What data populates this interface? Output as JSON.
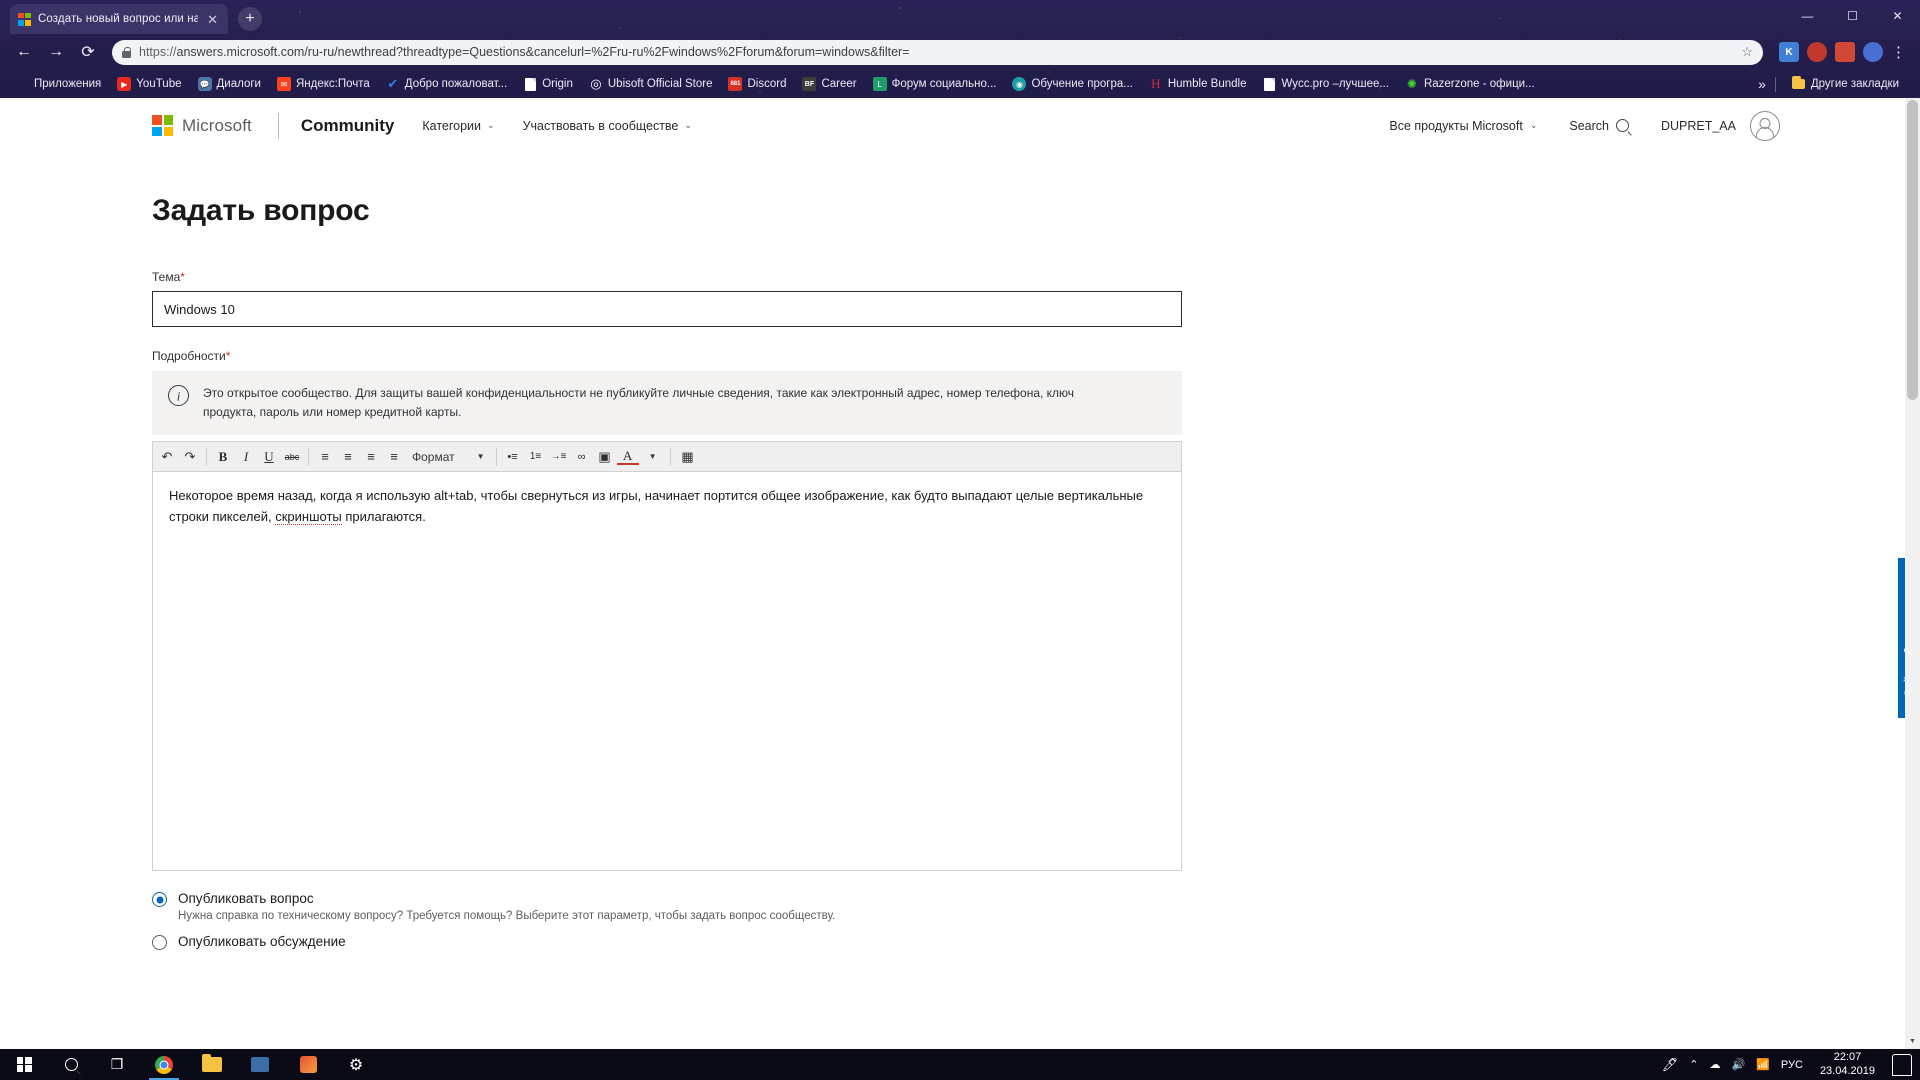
{
  "browser": {
    "tab": {
      "title": "Создать новый вопрос или нач",
      "favicon": "microsoft-logo-icon",
      "close": "✕"
    },
    "new_tab": "+",
    "window_controls": {
      "minimize": "—",
      "maximize": "☐",
      "close": "✕"
    },
    "nav": {
      "back": "←",
      "forward": "→",
      "reload": "⟳"
    },
    "url": {
      "scheme": "https://",
      "rest": "answers.microsoft.com/ru-ru/newthread?threadtype=Questions&cancelurl=%2Fru-ru%2Fwindows%2Fforum&forum=windows&filter=",
      "full": "https://answers.microsoft.com/ru-ru/newthread?threadtype=Questions&cancelurl=%2Fru-ru%2Fwindows%2Fforum&forum=windows&filter=",
      "bookmark_star": "☆",
      "lock": "lock-icon"
    },
    "extensions": [
      {
        "name": "extension-k",
        "label": "K",
        "color": "#3f7fd4"
      },
      {
        "name": "extension-adblock",
        "label": "●",
        "color": "#c0392b"
      },
      {
        "name": "extension-red",
        "label": "▲",
        "color": "#d14836"
      },
      {
        "name": "extension-blue",
        "label": "◆",
        "color": "#4a6fd4"
      }
    ],
    "menu": "⋮",
    "bookmarks": [
      {
        "label": "Приложения",
        "icon": "apps-grid-icon"
      },
      {
        "label": "YouTube",
        "icon": "youtube-icon"
      },
      {
        "label": "Диалоги",
        "icon": "dialogs-icon"
      },
      {
        "label": "Яндекс:Почта",
        "icon": "yandex-mail-icon"
      },
      {
        "label": "Добро пожаловат...",
        "icon": "checkmark-icon"
      },
      {
        "label": "Origin",
        "icon": "document-icon"
      },
      {
        "label": "Ubisoft Official Store",
        "icon": "ubisoft-icon"
      },
      {
        "label": "Discord",
        "icon": "discord-icon"
      },
      {
        "label": "Career",
        "icon": "bf-icon"
      },
      {
        "label": "Форум социально...",
        "icon": "forum-icon"
      },
      {
        "label": "Обучение програ...",
        "icon": "learning-icon"
      },
      {
        "label": "Humble Bundle",
        "icon": "humble-bundle-icon"
      },
      {
        "label": "Wycc.pro –лучшее...",
        "icon": "document-icon"
      },
      {
        "label": "Razerzone - офици...",
        "icon": "razer-icon"
      }
    ],
    "bookmarks_overflow": "»",
    "other_bookmarks": {
      "label": "Другие закладки",
      "icon": "folder-icon"
    }
  },
  "site_header": {
    "logo_word": "Microsoft",
    "brand": "Community",
    "nav": [
      {
        "label": "Категории",
        "caret": "⌄"
      },
      {
        "label": "Участвовать в сообществе",
        "caret": "⌄"
      }
    ],
    "all_products": {
      "label": "Все продукты Microsoft",
      "caret": "⌄"
    },
    "search": {
      "label": "Search",
      "icon": "search-icon"
    },
    "user": "DUPRET_AA",
    "avatar": "user-avatar-icon"
  },
  "main": {
    "title": "Задать вопрос",
    "subject": {
      "label": "Тема",
      "required": "*",
      "value": "Windows 10",
      "placeholder": ""
    },
    "details": {
      "label": "Подробности",
      "required": "*",
      "notice": "Это открытое сообщество. Для защиты вашей конфиденциальности не публикуйте личные сведения, такие как электронный адрес, номер телефона, ключ продукта, пароль или номер кредитной карты.",
      "notice_icon": "info-icon",
      "body_part1": "Некоторое время назад, когда я использую alt+tab, чтобы свернуться из игры, начинает портится общее изображение, как будто выпадают целые вертикальные строки пикселей, ",
      "body_spell": "скриншоты",
      "body_part2": " прилагаются."
    },
    "toolbar": [
      {
        "name": "undo-icon",
        "glyph": "↶"
      },
      {
        "name": "redo-icon",
        "glyph": "↷"
      },
      {
        "name": "bold-icon",
        "glyph": "B"
      },
      {
        "name": "italic-icon",
        "glyph": "I"
      },
      {
        "name": "underline-icon",
        "glyph": "U"
      },
      {
        "name": "strikethrough-icon",
        "glyph": "abc"
      },
      {
        "name": "align-left-icon",
        "glyph": "≡"
      },
      {
        "name": "align-center-icon",
        "glyph": "≡"
      },
      {
        "name": "align-right-icon",
        "glyph": "≡"
      },
      {
        "name": "align-justify-icon",
        "glyph": "≡"
      },
      {
        "name": "bullet-list-icon",
        "glyph": "•≡"
      },
      {
        "name": "numbered-list-icon",
        "glyph": "1≡"
      },
      {
        "name": "indent-icon",
        "glyph": "→≡"
      },
      {
        "name": "link-icon",
        "glyph": "∞"
      },
      {
        "name": "image-icon",
        "glyph": "▣"
      },
      {
        "name": "text-color-icon",
        "glyph": "A"
      },
      {
        "name": "table-icon",
        "glyph": "▦"
      }
    ],
    "format_dropdown": {
      "label": "Формат",
      "caret": "▼"
    },
    "color_caret": "▼",
    "options": [
      {
        "label": "Опубликовать вопрос",
        "description": "Нужна справка по техническому вопросу? Требуется помощь? Выберите этот параметр, чтобы задать вопрос сообществу.",
        "selected": true
      },
      {
        "label": "Опубликовать обсуждение",
        "description": "",
        "selected": false
      }
    ],
    "feedback_tab": "Сайт - обратная связь",
    "accent_color": "#0067b8"
  },
  "taskbar": {
    "start": "windows-start-icon",
    "search": "🔍",
    "task_view": "⧉",
    "apps": [
      {
        "name": "chrome-app-icon",
        "active": true
      },
      {
        "name": "file-explorer-icon",
        "active": false
      },
      {
        "name": "media-app-icon",
        "active": false
      },
      {
        "name": "photos-app-icon",
        "active": false
      },
      {
        "name": "settings-app-icon",
        "active": false
      }
    ],
    "tray": {
      "pen": "🖊",
      "chevron": "⌃",
      "onedrive": "☁",
      "volume": "🔊",
      "network": "📶",
      "language": "РУС",
      "time": "22:07",
      "date": "23.04.2019",
      "notifications": "notification-icon"
    }
  }
}
